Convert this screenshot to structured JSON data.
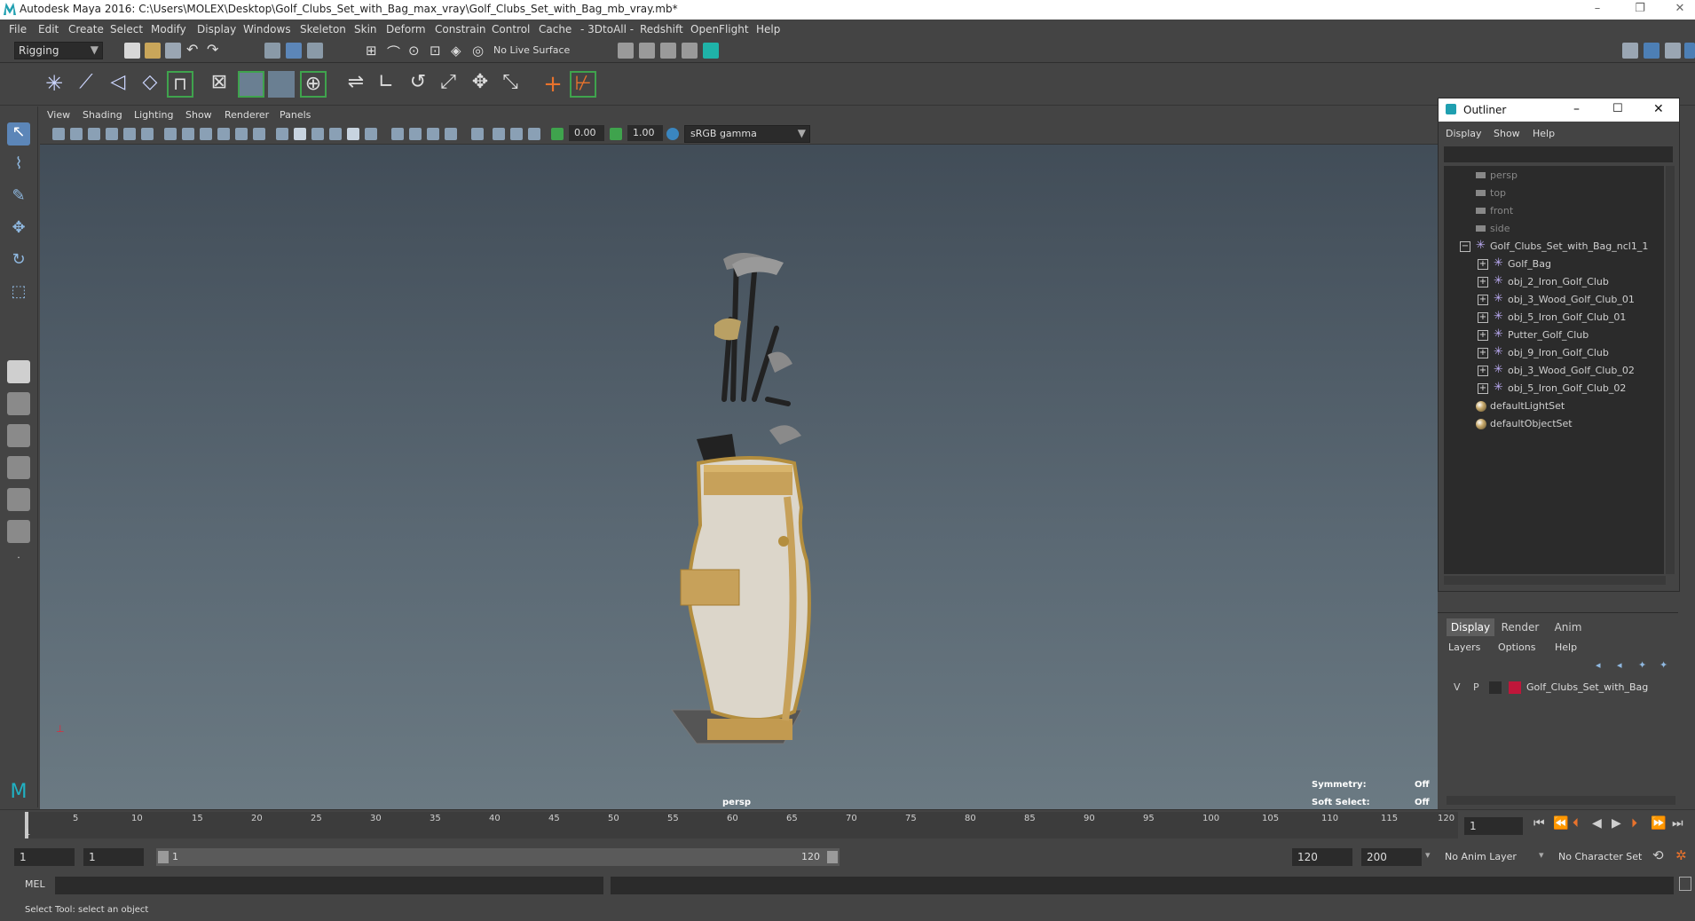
{
  "window": {
    "title": "Autodesk Maya 2016: C:\\Users\\MOLEX\\Desktop\\Golf_Clubs_Set_with_Bag_max_vray\\Golf_Clubs_Set_with_Bag_mb_vray.mb*",
    "minimize": "–",
    "restore": "❐",
    "close": "✕"
  },
  "menubar": {
    "items": [
      "File",
      "Edit",
      "Create",
      "Select",
      "Modify",
      "Display",
      "Windows",
      "Skeleton",
      "Skin",
      "Deform",
      "Constrain",
      "Control",
      "Cache",
      "- 3DtoAll -",
      "Redshift",
      "OpenFlight",
      "Help"
    ]
  },
  "statusline": {
    "mode": "Rigging",
    "live_surface": "No Live Surface"
  },
  "viewport": {
    "menu": [
      "View",
      "Shading",
      "Lighting",
      "Show",
      "Renderer",
      "Panels"
    ],
    "near_value": "0.00",
    "far_value": "1.00",
    "color_space": "sRGB gamma",
    "camera_label": "persp",
    "hud": {
      "symmetry_label": "Symmetry:",
      "symmetry_value": "Off",
      "soft_select_label": "Soft Select:",
      "soft_select_value": "Off"
    }
  },
  "outliner": {
    "title": "Outliner",
    "menu": [
      "Display",
      "Show",
      "Help"
    ],
    "cameras": [
      "persp",
      "top",
      "front",
      "side"
    ],
    "root": "Golf_Clubs_Set_with_Bag_ncl1_1",
    "children": [
      "Golf_Bag",
      "obj_2_Iron_Golf_Club",
      "obj_3_Wood_Golf_Club_01",
      "obj_5_Iron_Golf_Club_01",
      "Putter_Golf_Club",
      "obj_9_Iron_Golf_Club",
      "obj_3_Wood_Golf_Club_02",
      "obj_5_Iron_Golf_Club_02"
    ],
    "sets": [
      "defaultLightSet",
      "defaultObjectSet"
    ]
  },
  "layers": {
    "tabs": [
      "Display",
      "Render",
      "Anim"
    ],
    "menu": [
      "Layers",
      "Options",
      "Help"
    ],
    "layer": {
      "v": "V",
      "p": "P",
      "name": "Golf_Clubs_Set_with_Bag",
      "color": "#c0163a"
    }
  },
  "timeline": {
    "ticks": [
      "5",
      "10",
      "15",
      "20",
      "25",
      "30",
      "35",
      "40",
      "45",
      "50",
      "55",
      "60",
      "65",
      "70",
      "75",
      "80",
      "85",
      "90",
      "95",
      "100",
      "105",
      "110",
      "115",
      "120"
    ],
    "start_tick": "1",
    "current_frame": "1"
  },
  "range": {
    "start": "1",
    "start2": "1",
    "slider_start": "1",
    "slider_end": "120",
    "end": "120",
    "end2": "200",
    "anim_layer": "No Anim Layer",
    "character_set": "No Character Set"
  },
  "cmdline": {
    "label": "MEL"
  },
  "helpline": {
    "text": "Select Tool: select an object"
  }
}
